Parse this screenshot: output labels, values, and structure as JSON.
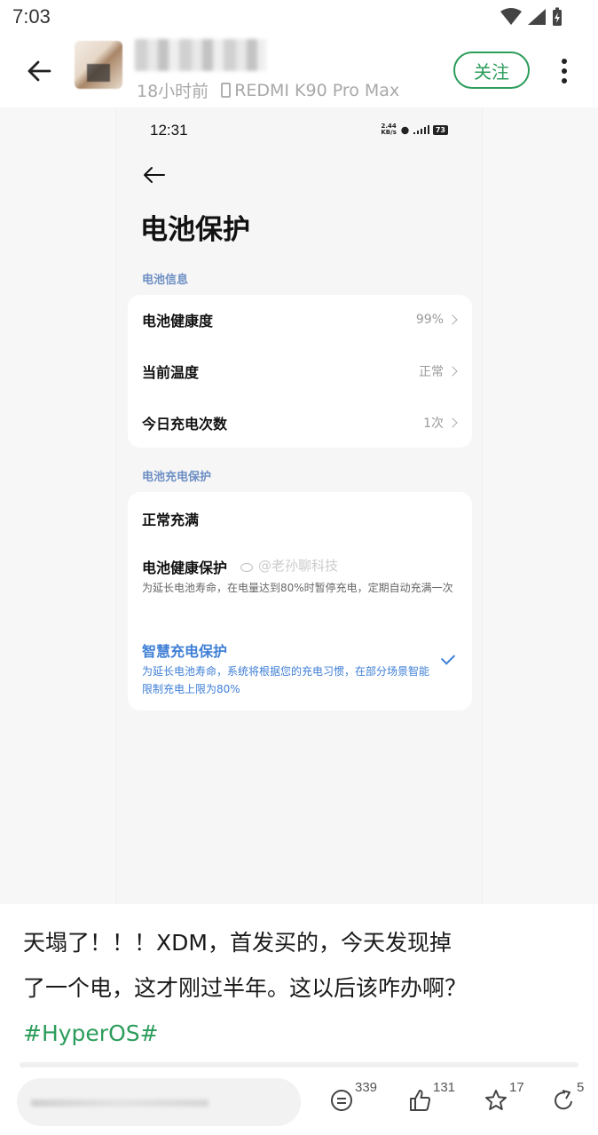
{
  "status_bar": {
    "time": "7:03"
  },
  "header": {
    "post_time": "18小时前",
    "device": "REDMI K90 Pro Max",
    "follow_label": "关注"
  },
  "screenshot": {
    "time": "12:31",
    "net_speed_value": "2.44",
    "net_speed_unit": "KB/s",
    "battery": "73",
    "page_title": "电池保护",
    "section_info": "电池信息",
    "info_rows": [
      {
        "label": "电池健康度",
        "value": "99%"
      },
      {
        "label": "当前温度",
        "value": "正常"
      },
      {
        "label": "今日充电次数",
        "value": "1次"
      }
    ],
    "section_charge": "电池充电保护",
    "options": [
      {
        "label": "正常充满",
        "desc": ""
      },
      {
        "label": "电池健康保护",
        "desc": "为延长电池寿命，在电量达到80%时暂停充电，定期自动充满一次"
      },
      {
        "label": "智慧充电保护",
        "desc": "为延长电池寿命，系统将根据您的充电习惯，在部分场景智能限制充电上限为80%"
      }
    ],
    "watermark": "@老孙聊科技"
  },
  "post": {
    "text_line1": "天塌了！！！XDM，首发买的，今天发现掉",
    "text_line2": "了一个电，这才刚过半年。这以后该咋办啊？",
    "hashtag": "#HyperOS#"
  },
  "actions": {
    "comments": "339",
    "likes": "131",
    "favorites": "17",
    "shares": "5"
  },
  "colors": {
    "accent_green": "#2c9d5b",
    "accent_blue": "#3f7fd6"
  }
}
